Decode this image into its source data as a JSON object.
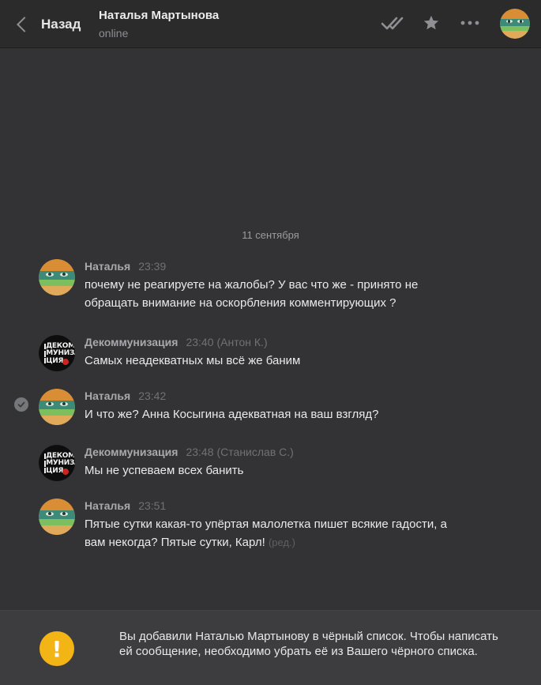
{
  "header": {
    "back_label": "Назад",
    "peer_name": "Наталья Мартынова",
    "peer_status": "online"
  },
  "icons": {
    "back": "chevron-left-icon",
    "read_all": "double-check-icon",
    "favorite": "star-icon",
    "more": "more-dots-icon",
    "warning": "exclamation-icon"
  },
  "chat": {
    "date_separator": "11 сентября",
    "messages": [
      {
        "author": "Наталья",
        "time": "23:39",
        "signature": "",
        "text": "почему не реагируете на жалобы? У вас что же - принято не обращать внимание на оскорбления комментирующих ?",
        "edited": ""
      },
      {
        "author": "Декоммунизация",
        "time": "23:40",
        "signature": "(Антон К.)",
        "text": "Самых неадекватных мы всё же баним",
        "edited": ""
      },
      {
        "author": "Наталья",
        "time": "23:42",
        "signature": "",
        "text": "И что же? Анна Косыгина адекватная на ваш взгляд?",
        "edited": ""
      },
      {
        "author": "Декоммунизация",
        "time": "23:48",
        "signature": "(Станислав С.)",
        "text": "Мы не успеваем всех банить",
        "edited": ""
      },
      {
        "author": "Наталья",
        "time": "23:51",
        "signature": "",
        "text": "Пятые сутки какая-то упёртая малолетка пишет всякие гадости, а вам некогда? Пятые сутки, Карл!",
        "edited": "(ред.)"
      }
    ]
  },
  "community_avatar_text": [
    "ДЕКОМ",
    "МУНИЗА",
    "ЦИЯ"
  ],
  "footer": {
    "notice": "Вы добавили Наталью Мартынову в чёрный список. Чтобы написать ей сообщение, необходимо убрать её из Вашего чёрного списка.",
    "warning_glyph": "!"
  },
  "colors": {
    "background": "#333335",
    "header": "#2b2b2c",
    "warning": "#f3b415"
  }
}
